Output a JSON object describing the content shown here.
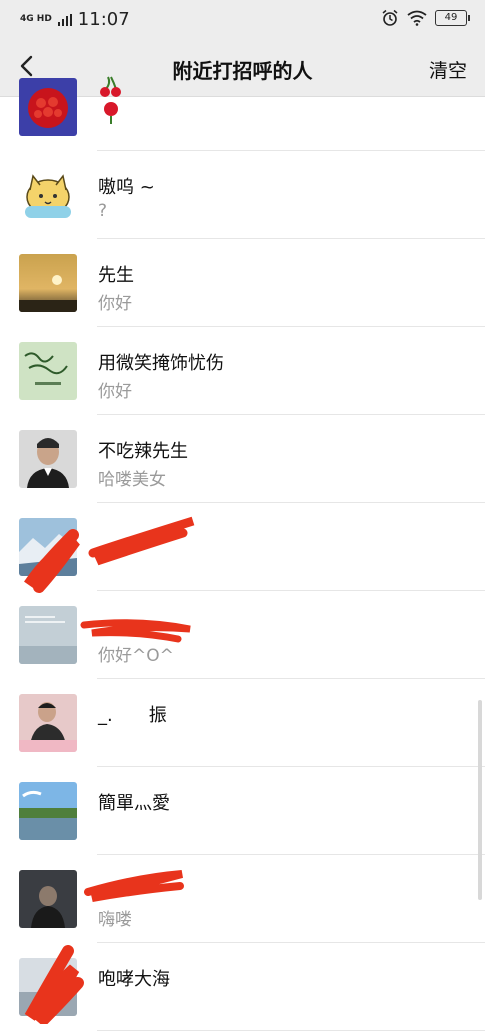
{
  "status_bar": {
    "network": "4G HD",
    "time": "11:07",
    "battery": "49",
    "icons": [
      "signal-icon",
      "alarm-icon",
      "wifi-icon",
      "battery-icon"
    ]
  },
  "nav": {
    "title": "附近打招呼的人",
    "clear_label": "清空",
    "back_icon": "chevron-left-icon"
  },
  "greetings": [
    {
      "name": "",
      "message": ""
    },
    {
      "name": "嗷呜 ~",
      "message": "?"
    },
    {
      "name": "先生",
      "message": "你好"
    },
    {
      "name": "用微笑掩饰忧伤",
      "message": "你好"
    },
    {
      "name": "不吃辣先生",
      "message": "哈喽美女"
    },
    {
      "name": "",
      "message": ""
    },
    {
      "name": "",
      "message": "你好^O^"
    },
    {
      "name": "_.　　振",
      "message": ""
    },
    {
      "name": "簡單灬愛",
      "message": ""
    },
    {
      "name": "",
      "message": "嗨喽"
    },
    {
      "name": "咆哮大海",
      "message": ""
    }
  ],
  "colors": {
    "nav_bg": "#ededed",
    "redaction": "#e8341c",
    "secondary_text": "#9a9a9a"
  }
}
